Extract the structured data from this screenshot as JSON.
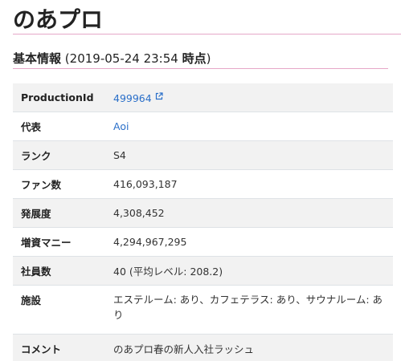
{
  "page": {
    "title": "のあプロ"
  },
  "section": {
    "title": "基本情報",
    "timestamp_open": "(2019-05-24 23:54 ",
    "timestamp_label": "時点",
    "timestamp_close": ")"
  },
  "rows": [
    {
      "label": "ProductionId",
      "value": "499964"
    },
    {
      "label": "代表",
      "value": "Aoi"
    },
    {
      "label": "ランク",
      "value": "S4"
    },
    {
      "label": "ファン数",
      "value": "416,093,187"
    },
    {
      "label": "発展度",
      "value": "4,308,452"
    },
    {
      "label": "増資マニー",
      "value": "4,294,967,295"
    },
    {
      "label": "社員数",
      "value": "40 (平均レベル: 208.2)"
    },
    {
      "label": "施設",
      "value": "エステルーム: あり、カフェテラス: あり、サウナルーム: あり"
    },
    {
      "label": "コメント",
      "value": "のあプロ春の新人入社ラッシュ"
    }
  ],
  "icons": {
    "external_link": "external-link-icon"
  },
  "colors": {
    "accent_rule": "#e6a7c8",
    "link": "#2a6fc9",
    "stripe": "#f2f2f2"
  }
}
